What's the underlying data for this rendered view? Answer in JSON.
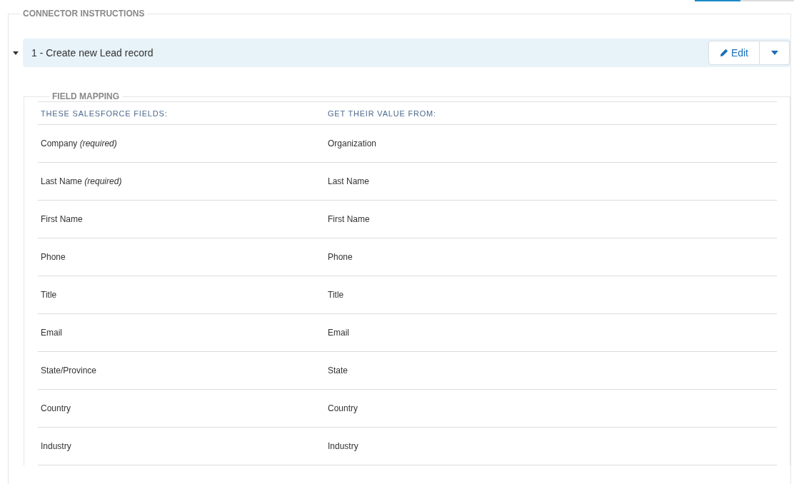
{
  "section": {
    "legend": "CONNECTOR INSTRUCTIONS"
  },
  "step": {
    "title": "1 - Create new Lead record",
    "expanded": true,
    "edit_label": "Edit"
  },
  "field_mapping": {
    "legend": "FIELD MAPPING",
    "columns": [
      "THESE SALESFORCE FIELDS:",
      "GET THEIR VALUE FROM:"
    ],
    "rows": [
      {
        "field": "Company *(required)*",
        "source": "Organization"
      },
      {
        "field": "Last Name *(required)*",
        "source": "Last Name"
      },
      {
        "field": "First Name",
        "source": "First Name"
      },
      {
        "field": "Phone",
        "source": "Phone"
      },
      {
        "field": "Title",
        "source": "Title"
      },
      {
        "field": "Email",
        "source": "Email"
      },
      {
        "field": "State/Province",
        "source": "State"
      },
      {
        "field": "Country",
        "source": "Country"
      },
      {
        "field": "Industry",
        "source": "Industry"
      }
    ]
  }
}
